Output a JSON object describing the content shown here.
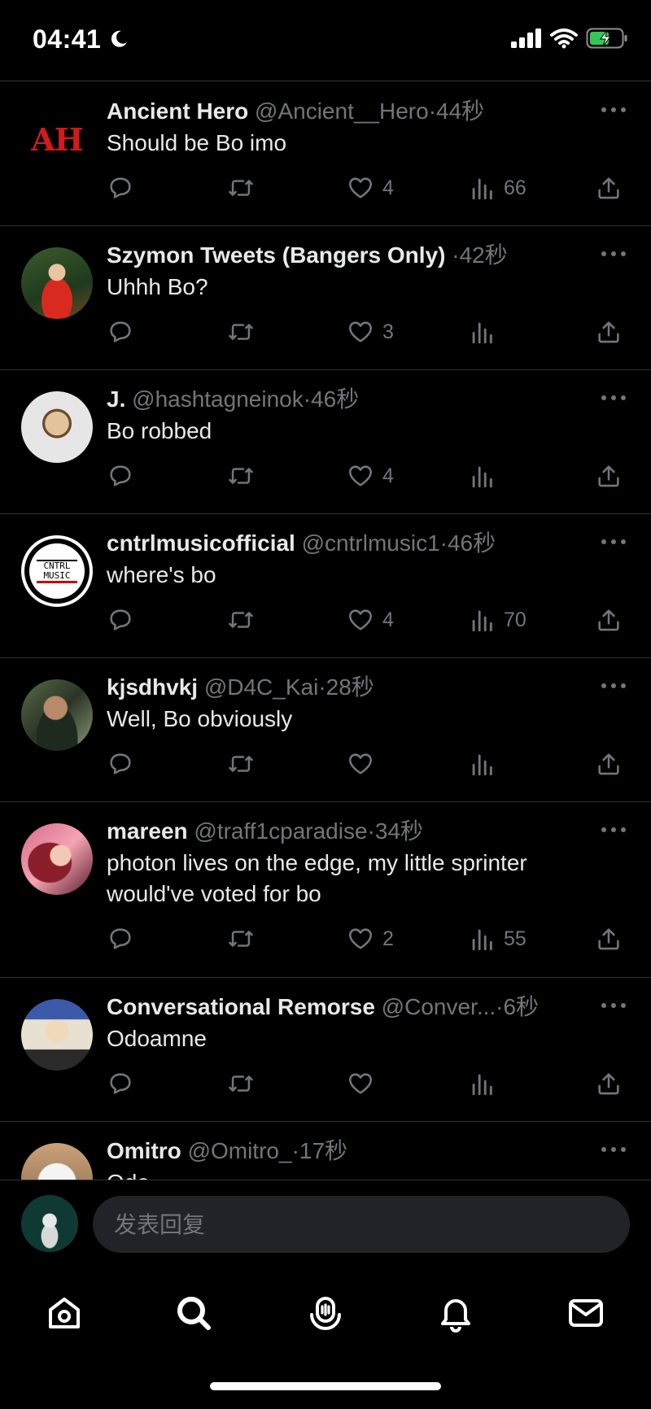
{
  "status_bar": {
    "time": "04:41",
    "moon_icon": "moon-icon",
    "signal_icon": "cellular-signal-icon",
    "wifi_icon": "wifi-icon",
    "battery_icon": "battery-charging-icon"
  },
  "tweets": [
    {
      "name": "Ancient Hero",
      "handle": "@Ancient__Hero",
      "dot": "·",
      "time": "44秒",
      "text": "Should be Bo imo",
      "likes": "4",
      "views": "66",
      "avatar_initials": "AH"
    },
    {
      "name": "Szymon Tweets (Bangers Only)",
      "handle": "",
      "dot": "·",
      "time": "42秒",
      "text": "Uhhh Bo?",
      "likes": "3",
      "views": ""
    },
    {
      "name": "J.",
      "handle": "@hashtagneinok",
      "dot": "·",
      "time": "46秒",
      "text": "Bo robbed",
      "likes": "4",
      "views": ""
    },
    {
      "name": "cntrlmusicofficial",
      "handle": "@cntrlmusic1",
      "dot": "·",
      "time": "46秒",
      "text": "where's bo",
      "likes": "4",
      "views": "70",
      "avatar_text": "CNTRL MUSIC"
    },
    {
      "name": "kjsdhvkj",
      "handle": "@D4C_Kai",
      "dot": "·",
      "time": "28秒",
      "text": "Well, Bo obviously",
      "likes": "",
      "views": ""
    },
    {
      "name": "mareen",
      "handle": "@traff1cparadise",
      "dot": "·",
      "time": "34秒",
      "text": "photon lives on the edge, my little sprinter would've voted for bo",
      "likes": "2",
      "views": "55"
    },
    {
      "name": "Conversational Remorse",
      "handle": "@Conver...",
      "dot": "·",
      "time": "6秒",
      "text": "Odoamne",
      "likes": "",
      "views": ""
    },
    {
      "name": "Omitro",
      "handle": "@Omitro_",
      "dot": "·",
      "time": "17秒",
      "text": "Odo",
      "likes": "",
      "views": ""
    }
  ],
  "reply": {
    "placeholder": "发表回复"
  },
  "nav": {
    "items": [
      "home-icon",
      "search-icon",
      "spaces-icon",
      "notifications-icon",
      "messages-icon"
    ]
  },
  "colors": {
    "background": "#000000",
    "text_primary": "#e7e9ea",
    "text_secondary": "#71767b",
    "divider": "#2f3336",
    "input_bg": "#202327",
    "battery_green": "#34c759"
  }
}
